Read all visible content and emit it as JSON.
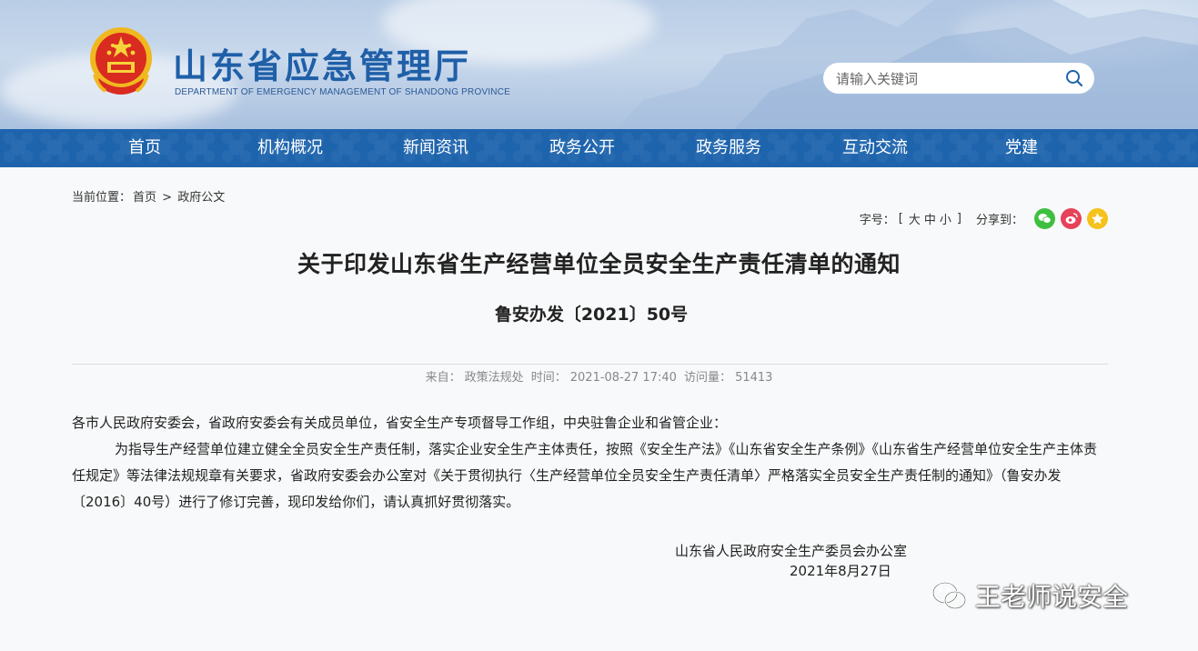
{
  "header": {
    "title": "山东省应急管理厅",
    "subtitle": "DEPARTMENT OF EMERGENCY MANAGEMENT OF SHANDONG PROVINCE",
    "search_placeholder": "请输入关键词"
  },
  "nav": {
    "items": [
      {
        "label": "首页"
      },
      {
        "label": "机构概况"
      },
      {
        "label": "新闻资讯"
      },
      {
        "label": "政务公开"
      },
      {
        "label": "政务服务"
      },
      {
        "label": "互动交流"
      },
      {
        "label": "党建"
      }
    ]
  },
  "breadcrumb": {
    "prefix": "当前位置：",
    "home": "首页",
    "separator": ">",
    "current": "政府公文"
  },
  "tools": {
    "font_label": "字号：",
    "bracket_open": "[",
    "large": "大",
    "medium": "中",
    "small": "小",
    "bracket_close": "]",
    "share_label": "分享到：",
    "share_icons": [
      "wechat-icon",
      "weibo-icon",
      "qzone-icon"
    ],
    "colors": {
      "wechat": "#3fbf3f",
      "weibo": "#e6425a",
      "qzone": "#f5c21b"
    }
  },
  "article": {
    "title": "关于印发山东省生产经营单位全员安全生产责任清单的通知",
    "doc_number": "鲁安办发〔2021〕50号",
    "meta": {
      "source_label": "来自：",
      "source": "政策法规处",
      "time_label": "时间：",
      "time": "2021-08-27 17:40",
      "views_label": "访问量：",
      "views": "51413"
    },
    "salutation": "各市人民政府安委会，省政府安委会有关成员单位，省安全生产专项督导工作组，中央驻鲁企业和省管企业：",
    "paragraph": "为指导生产经营单位建立健全全员安全生产责任制，落实企业安全生产主体责任，按照《安全生产法》《山东省安全生产条例》《山东省生产经营单位安全生产主体责任规定》等法律法规规章有关要求，省政府安委会办公室对《关于贯彻执行〈生产经营单位全员安全生产责任清单〉严格落实全员安全生产责任制的通知》（鲁安办发〔2016〕40号）进行了修订完善，现印发给你们，请认真抓好贯彻落实。",
    "signature_org": "山东省人民政府安全生产委员会办公室",
    "signature_date": "2021年8月27日"
  },
  "watermark": {
    "text": "王老师说安全"
  },
  "colors": {
    "nav_bg": "#1e64ad",
    "title_blue": "#1f5fa8"
  }
}
